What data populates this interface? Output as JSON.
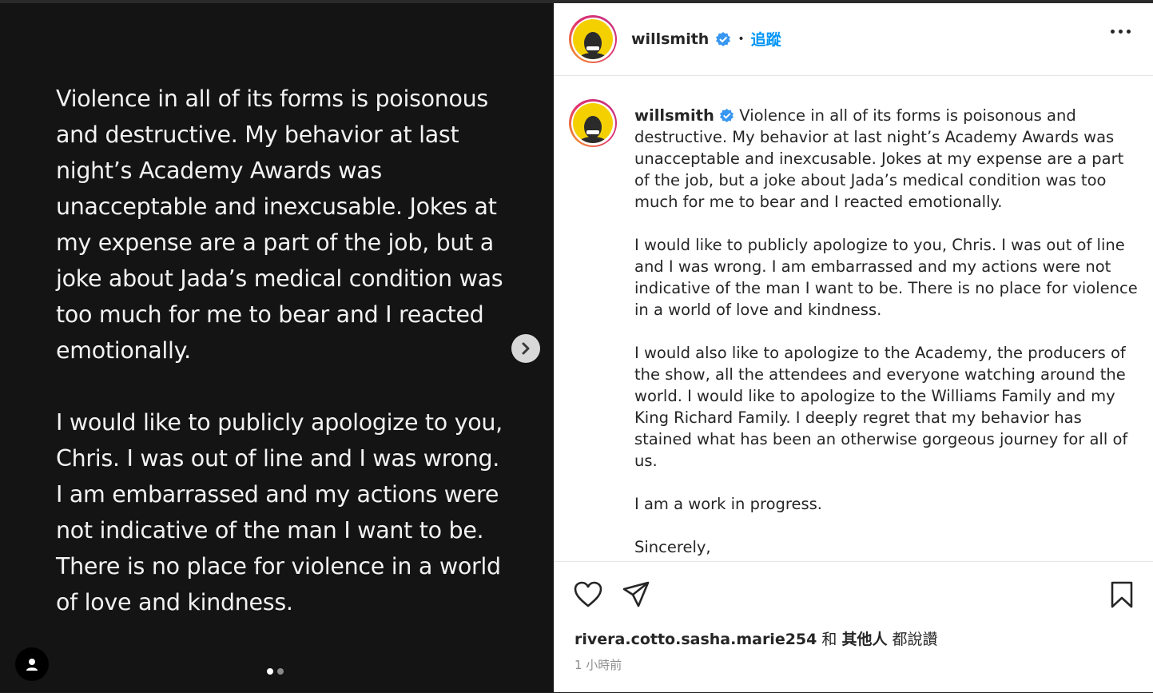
{
  "media": {
    "text": "Violence in all of its forms is poisonous\nand destructive. My behavior at last\nnight’s Academy Awards was\nunacceptable and inexcusable. Jokes at\nmy expense are a part of the job, but a\njoke about Jada’s medical condition was\ntoo much for me to bear and I reacted\nemotionally.\n\nI would like to publicly apologize to you,\nChris. I was out of line and I was wrong.\nI am embarrassed and my actions were\nnot indicative of the man I want to be.\nThere is no place for violence in a world\nof love and kindness.",
    "carousel_total": 2,
    "carousel_current": 1,
    "next_icon": "chevron-right-icon",
    "tag_icon": "user-tag-icon"
  },
  "header": {
    "username": "willsmith",
    "separator": "•",
    "follow_label": "追蹤",
    "more_icon": "more-options-icon"
  },
  "caption": {
    "username": "willsmith",
    "text": "Violence in all of its forms is poisonous and destructive. My behavior at last night’s Academy Awards was unacceptable and inexcusable. Jokes at my expense are a part of the job, but a joke about Jada’s medical condition was too much for me to bear and I reacted emotionally.\n\nI would like to publicly apologize to you, Chris. I was out of line and I was wrong. I am embarrassed and my actions were not indicative of the man I want to be. There is no place for violence in a world of love and kindness.\n\nI would also like to apologize to the Academy, the producers of the show, all the attendees and everyone watching around the world. I would like to apologize to the Williams Family and my King Richard Family. I deeply regret that my behavior has stained what has been an otherwise gorgeous journey for all of us.\n\nI am a work in progress.\n\nSincerely,"
  },
  "actions": {
    "like_icon": "heart-icon",
    "share_icon": "send-icon",
    "save_icon": "bookmark-icon",
    "liked_by_user": "rivera.cotto.sasha.marie254",
    "liked_by_and": " 和 ",
    "liked_by_others": "其他人",
    "liked_by_suffix": " 都說讚",
    "timestamp": "1 小時前"
  },
  "colors": {
    "accent": "#0095f6",
    "verified": "#3897f0",
    "avatar_bg": "#f4d000"
  }
}
